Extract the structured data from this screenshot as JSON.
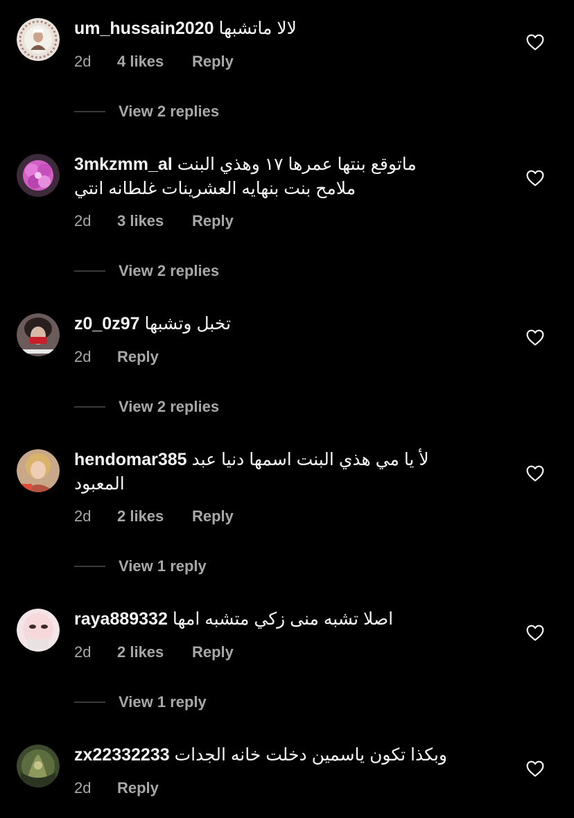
{
  "colors": {
    "background": "#000000",
    "primary_text": "#f5f5f5",
    "secondary_text": "#a8a8a8",
    "divider": "#3a3a3a"
  },
  "icons": {
    "like": "heart-outline-icon"
  },
  "comments": [
    {
      "username": "um_hussain2020",
      "text_lines": [
        "لالا ماتشبها"
      ],
      "time": "2d",
      "likes": "4 likes",
      "reply_label": "Reply",
      "view_replies": "View 2 replies"
    },
    {
      "username": "3mkzmm_al",
      "text_lines": [
        "ماتوقع بنتها عمرها ١٧ وهذي البنت",
        "ملامح بنت بنهايه العشرينات غلطانه انتي"
      ],
      "time": "2d",
      "likes": "3 likes",
      "reply_label": "Reply",
      "view_replies": "View 2 replies"
    },
    {
      "username": "z0_0z97",
      "text_lines": [
        "تخبل وتشبها"
      ],
      "time": "2d",
      "likes": "",
      "reply_label": "Reply",
      "view_replies": "View 2 replies"
    },
    {
      "username": "hendomar385",
      "text_lines": [
        "لأ يا مي هذي البنت اسمها دنيا عبد",
        "المعبود"
      ],
      "time": "2d",
      "likes": "2 likes",
      "reply_label": "Reply",
      "view_replies": "View 1 reply"
    },
    {
      "username": "raya889332",
      "text_lines": [
        "اصلا تشبه منى زكي متشبه امها"
      ],
      "time": "2d",
      "likes": "2 likes",
      "reply_label": "Reply",
      "view_replies": "View 1 reply"
    },
    {
      "username": "zx22332233",
      "text_lines": [
        "وبكذا تكون ياسمين دخلت خانه الجدات"
      ],
      "time": "2d",
      "likes": "",
      "reply_label": "Reply",
      "view_replies": ""
    }
  ]
}
